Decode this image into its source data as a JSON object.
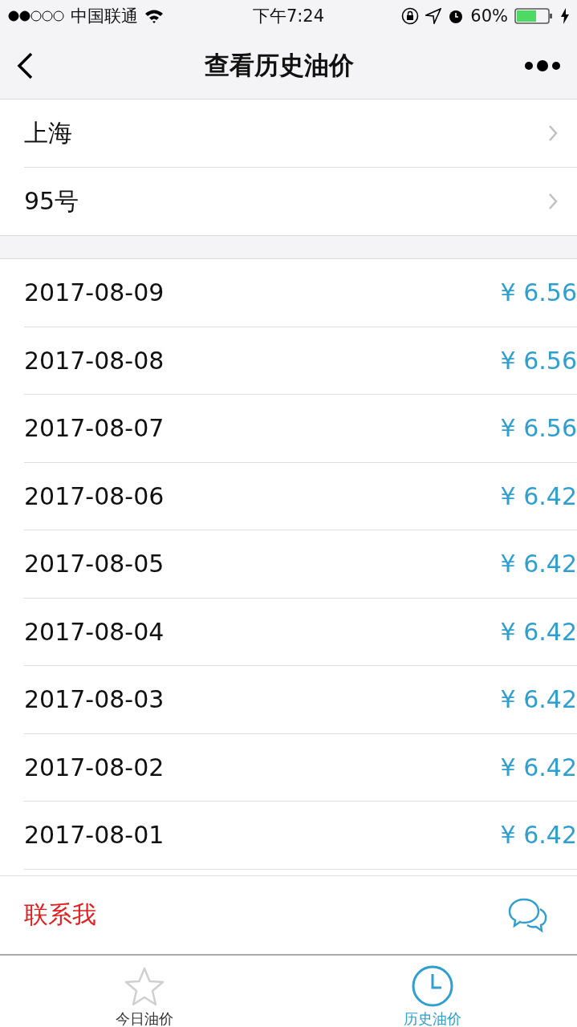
{
  "status_bar": {
    "carrier": "中国联通",
    "time": "下午7:24",
    "battery": "60%"
  },
  "nav": {
    "title": "查看历史油价"
  },
  "selectors": [
    {
      "label": "上海"
    },
    {
      "label": "95号"
    }
  ],
  "prices": [
    {
      "date": "2017-08-09",
      "price": "¥ 6.56"
    },
    {
      "date": "2017-08-08",
      "price": "¥ 6.56"
    },
    {
      "date": "2017-08-07",
      "price": "¥ 6.56"
    },
    {
      "date": "2017-08-06",
      "price": "¥ 6.42"
    },
    {
      "date": "2017-08-05",
      "price": "¥ 6.42"
    },
    {
      "date": "2017-08-04",
      "price": "¥ 6.42"
    },
    {
      "date": "2017-08-03",
      "price": "¥ 6.42"
    },
    {
      "date": "2017-08-02",
      "price": "¥ 6.42"
    },
    {
      "date": "2017-08-01",
      "price": "¥ 6.42"
    }
  ],
  "contact": {
    "label": "联系我"
  },
  "tabs": [
    {
      "label": "今日油价",
      "kind": "star",
      "selected": false
    },
    {
      "label": "历史油价",
      "kind": "clock",
      "selected": true
    }
  ]
}
